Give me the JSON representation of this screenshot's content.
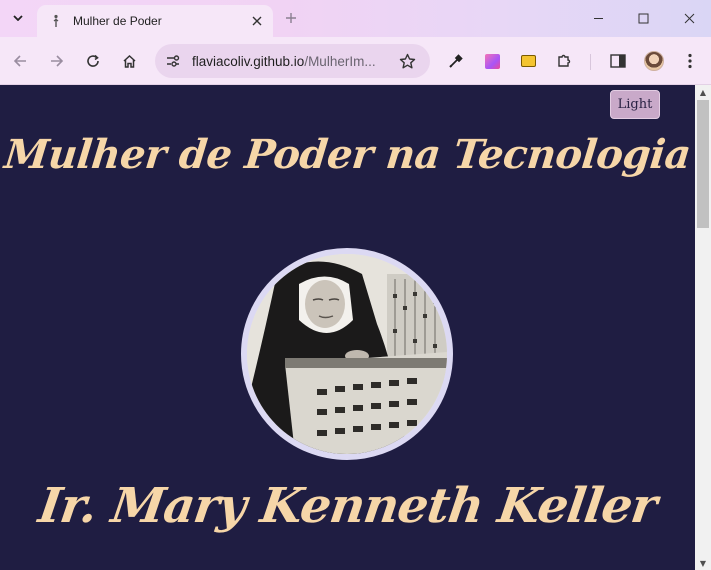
{
  "browser": {
    "tab": {
      "title": "Mulher de Poder"
    },
    "address": {
      "host": "flaviacoliv.github.io",
      "path": "/MulherIm..."
    }
  },
  "page": {
    "theme_toggle_label": "Light",
    "heading": "Mulher de Poder na Tecnologia",
    "portrait_alt": "Ir. Mary Kenneth Keller",
    "name": "Ir. Mary Kenneth Keller"
  },
  "colors": {
    "page_background": "#1f1d42",
    "heading_text": "#f6d6a8",
    "portrait_border": "#dcd9f3",
    "toggle_button": "#c9a9c9"
  }
}
